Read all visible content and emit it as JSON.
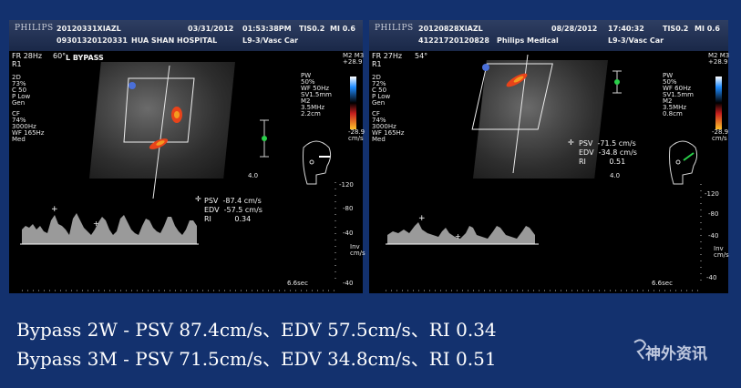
{
  "left_panel": {
    "brand": "PHILIPS",
    "patient_id": "20120331XIAZL",
    "date": "03/31/2012",
    "time": "01:53:38PM",
    "tis": "TIS0.2",
    "mi": "MI 0.6",
    "exam_id": "09301320120331",
    "hospital": "HUA SHAN HOSPITAL",
    "probe": "L9-3/Vasc Car",
    "frame_rate": "FR 28Hz",
    "angle": "60°",
    "r_label": "R1",
    "region_label": "L  BYPASS",
    "settings_2d": "2D\n73%\nC 50\nP Low\nGen",
    "settings_cf": "CF\n74%\n3000Hz\nWF 165Hz\nMed",
    "settings_pw": "PW\n50%\nWF 50Hz\nSV1.5mm\nM2\n3.5MHz\n2.2cm",
    "scale_top": "M2 M3\n+28.9",
    "scale_bottom": "-28.9\ncm/s",
    "depth": "4.0",
    "measurements": "PSV  -87.4 cm/s\nEDV  -57.5 cm/s\nRI          0.34",
    "velocity_ticks": [
      "-120",
      "-80",
      "-40",
      "-40"
    ],
    "inv_label": "Inv\ncm/s",
    "sweep": "6.6sec"
  },
  "right_panel": {
    "brand": "PHILIPS",
    "patient_id": "20120828XIAZL",
    "date": "08/28/2012",
    "time": "17:40:32",
    "tis": "TIS0.2",
    "mi": "MI 0.6",
    "exam_id": "41221720120828",
    "hospital": "Philips Medical",
    "probe": "L9-3/Vasc Car",
    "frame_rate": "FR 27Hz",
    "angle": "54°",
    "r_label": "R1",
    "settings_2d": "2D\n72%\nC 50\nP Low\nGen",
    "settings_cf": "CF\n74%\n3000Hz\nWF 165Hz\nMed",
    "settings_pw": "PW\n50%\nWF 60Hz\nSV1.5mm\nM2\n3.5MHz\n0.8cm",
    "scale_top": "M2 M3\n+28.9",
    "scale_bottom": "-28.9\ncm/s",
    "depth": "4.0",
    "measurements": "PSV  -71.5 cm/s\nEDV  -34.8 cm/s\nRI          0.51",
    "velocity_ticks": [
      "-120",
      "-80",
      "-40",
      "-40"
    ],
    "inv_label": "Inv\ncm/s",
    "sweep": "6.6sec"
  },
  "captions": {
    "line1": "Bypass 2W - PSV 87.4cm/s、EDV 57.5cm/s、RI 0.34",
    "line2": "Bypass 3M - PSV 71.5cm/s、EDV 34.8cm/s、RI 0.51"
  },
  "watermark": {
    "text": "神外资讯"
  },
  "colors": {
    "background": "#13316e",
    "doppler_red": "#e8431a",
    "doppler_orange": "#f39b1f",
    "green_marker": "#2ad04a"
  }
}
